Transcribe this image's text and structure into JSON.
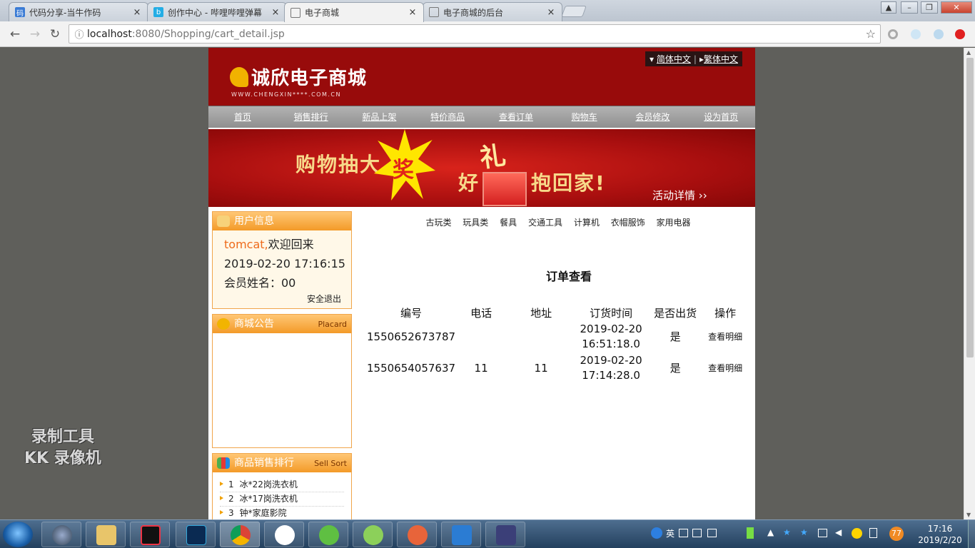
{
  "browser": {
    "tabs": [
      {
        "title": "代码分享-当牛作码",
        "active": false
      },
      {
        "title": "创作中心 - 哔哩哔哩弹幕",
        "active": false
      },
      {
        "title": "电子商城",
        "active": true
      },
      {
        "title": "电子商城的后台",
        "active": false
      }
    ],
    "url_host": "localhost",
    "url_path": ":8080/Shopping/cart_detail.jsp",
    "close_glyph": "×"
  },
  "site": {
    "logo_name": "诚欣电子商城",
    "logo_sub": "WWW.CHENGXIN****.COM.CN",
    "lang_simplified": "简体中文",
    "lang_traditional": "繁体中文",
    "menu": [
      "首页",
      "销售排行",
      "新品上架",
      "特价商品",
      "查看订单",
      "购物车",
      "会员修改",
      "设为首页"
    ],
    "banner": {
      "text1": "购物抽大",
      "burst": "奖",
      "text2": "好",
      "gift": "礼",
      "text3": "抱回家!",
      "more": "活动详情 ››"
    }
  },
  "sidebar": {
    "user_box": {
      "title": "用户信息",
      "username": "tomcat,",
      "welcome": "欢迎回来",
      "datetime": "2019-02-20 17:16:15",
      "member_name": "会员姓名：00",
      "logout": "安全退出"
    },
    "notice_box": {
      "title": "商城公告",
      "title_en": "Placard"
    },
    "rank_box": {
      "title": "商品销售排行",
      "title_en": "Sell Sort",
      "items": [
        {
          "no": "1",
          "name": "冰*22岗洗衣机"
        },
        {
          "no": "2",
          "name": "冰*17岗洗衣机"
        },
        {
          "no": "3",
          "name": "钟*家庭影院"
        }
      ]
    }
  },
  "main": {
    "categories": [
      "古玩类",
      "玩具类",
      "餐具",
      "交通工具",
      "计算机",
      "衣帽服饰",
      "家用电器"
    ],
    "order_title": "订单查看",
    "table": {
      "headers": [
        "编号",
        "电话",
        "地址",
        "订货时间",
        "是否出货",
        "操作"
      ],
      "rows": [
        {
          "id": "1550652673787",
          "phone": "",
          "address": "",
          "date": "2019-02-20",
          "time": "16:51:18.0",
          "shipped": "是",
          "action": "查看明细"
        },
        {
          "id": "1550654057637",
          "phone": "11",
          "address": "11",
          "date": "2019-02-20",
          "time": "17:14:28.0",
          "shipped": "是",
          "action": "查看明细"
        }
      ]
    }
  },
  "watermark": {
    "line1": "录制工具",
    "line2": "KK 录像机"
  },
  "taskbar": {
    "ime": "英",
    "badge": "77",
    "clock_time": "17:16",
    "clock_date": "2019/2/20"
  }
}
